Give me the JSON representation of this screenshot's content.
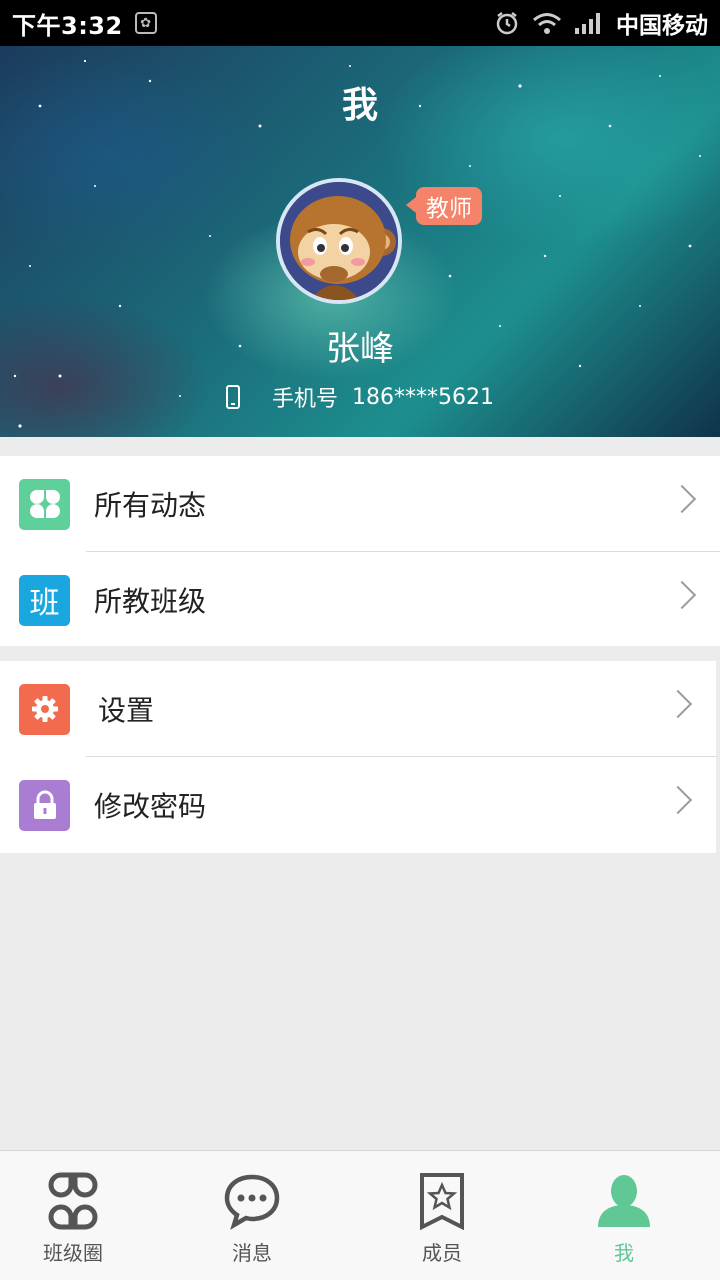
{
  "status_bar": {
    "time": "下午3:32",
    "carrier": "中国移动",
    "icons": [
      "alarm-icon",
      "wifi-icon",
      "signal-icon"
    ]
  },
  "header": {
    "title": "我",
    "role_badge": "教师",
    "username": "张峰",
    "phone_label": "手机号",
    "phone_number": "186****5621"
  },
  "menu": {
    "group1": [
      {
        "label": "所有动态",
        "icon": "clover-icon",
        "color": "#5fcf9b"
      },
      {
        "label": "所教班级",
        "icon_text": "班",
        "color": "#1aa7e0"
      }
    ],
    "group2": [
      {
        "label": "设置",
        "icon": "gear-icon",
        "color": "#f26b4f"
      },
      {
        "label": "修改密码",
        "icon": "lock-icon",
        "color": "#a97ed2"
      }
    ]
  },
  "tabbar": {
    "tabs": [
      {
        "label": "班级圈",
        "icon": "clover-outline-icon"
      },
      {
        "label": "消息",
        "icon": "chat-bubble-icon"
      },
      {
        "label": "成员",
        "icon": "bookmark-star-icon"
      },
      {
        "label": "我",
        "icon": "person-icon",
        "active": true
      }
    ],
    "active_color": "#5fc895"
  }
}
